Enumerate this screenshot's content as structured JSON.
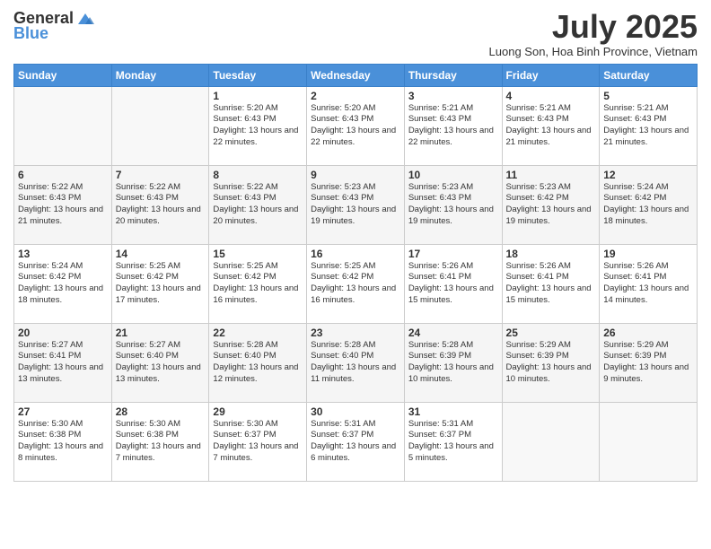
{
  "header": {
    "logo_general": "General",
    "logo_blue": "Blue",
    "month_title": "July 2025",
    "location": "Luong Son, Hoa Binh Province, Vietnam"
  },
  "days_of_week": [
    "Sunday",
    "Monday",
    "Tuesday",
    "Wednesday",
    "Thursday",
    "Friday",
    "Saturday"
  ],
  "weeks": [
    [
      {
        "day": "",
        "info": ""
      },
      {
        "day": "",
        "info": ""
      },
      {
        "day": "1",
        "info": "Sunrise: 5:20 AM\nSunset: 6:43 PM\nDaylight: 13 hours and 22 minutes."
      },
      {
        "day": "2",
        "info": "Sunrise: 5:20 AM\nSunset: 6:43 PM\nDaylight: 13 hours and 22 minutes."
      },
      {
        "day": "3",
        "info": "Sunrise: 5:21 AM\nSunset: 6:43 PM\nDaylight: 13 hours and 22 minutes."
      },
      {
        "day": "4",
        "info": "Sunrise: 5:21 AM\nSunset: 6:43 PM\nDaylight: 13 hours and 21 minutes."
      },
      {
        "day": "5",
        "info": "Sunrise: 5:21 AM\nSunset: 6:43 PM\nDaylight: 13 hours and 21 minutes."
      }
    ],
    [
      {
        "day": "6",
        "info": "Sunrise: 5:22 AM\nSunset: 6:43 PM\nDaylight: 13 hours and 21 minutes."
      },
      {
        "day": "7",
        "info": "Sunrise: 5:22 AM\nSunset: 6:43 PM\nDaylight: 13 hours and 20 minutes."
      },
      {
        "day": "8",
        "info": "Sunrise: 5:22 AM\nSunset: 6:43 PM\nDaylight: 13 hours and 20 minutes."
      },
      {
        "day": "9",
        "info": "Sunrise: 5:23 AM\nSunset: 6:43 PM\nDaylight: 13 hours and 19 minutes."
      },
      {
        "day": "10",
        "info": "Sunrise: 5:23 AM\nSunset: 6:43 PM\nDaylight: 13 hours and 19 minutes."
      },
      {
        "day": "11",
        "info": "Sunrise: 5:23 AM\nSunset: 6:42 PM\nDaylight: 13 hours and 19 minutes."
      },
      {
        "day": "12",
        "info": "Sunrise: 5:24 AM\nSunset: 6:42 PM\nDaylight: 13 hours and 18 minutes."
      }
    ],
    [
      {
        "day": "13",
        "info": "Sunrise: 5:24 AM\nSunset: 6:42 PM\nDaylight: 13 hours and 18 minutes."
      },
      {
        "day": "14",
        "info": "Sunrise: 5:25 AM\nSunset: 6:42 PM\nDaylight: 13 hours and 17 minutes."
      },
      {
        "day": "15",
        "info": "Sunrise: 5:25 AM\nSunset: 6:42 PM\nDaylight: 13 hours and 16 minutes."
      },
      {
        "day": "16",
        "info": "Sunrise: 5:25 AM\nSunset: 6:42 PM\nDaylight: 13 hours and 16 minutes."
      },
      {
        "day": "17",
        "info": "Sunrise: 5:26 AM\nSunset: 6:41 PM\nDaylight: 13 hours and 15 minutes."
      },
      {
        "day": "18",
        "info": "Sunrise: 5:26 AM\nSunset: 6:41 PM\nDaylight: 13 hours and 15 minutes."
      },
      {
        "day": "19",
        "info": "Sunrise: 5:26 AM\nSunset: 6:41 PM\nDaylight: 13 hours and 14 minutes."
      }
    ],
    [
      {
        "day": "20",
        "info": "Sunrise: 5:27 AM\nSunset: 6:41 PM\nDaylight: 13 hours and 13 minutes."
      },
      {
        "day": "21",
        "info": "Sunrise: 5:27 AM\nSunset: 6:40 PM\nDaylight: 13 hours and 13 minutes."
      },
      {
        "day": "22",
        "info": "Sunrise: 5:28 AM\nSunset: 6:40 PM\nDaylight: 13 hours and 12 minutes."
      },
      {
        "day": "23",
        "info": "Sunrise: 5:28 AM\nSunset: 6:40 PM\nDaylight: 13 hours and 11 minutes."
      },
      {
        "day": "24",
        "info": "Sunrise: 5:28 AM\nSunset: 6:39 PM\nDaylight: 13 hours and 10 minutes."
      },
      {
        "day": "25",
        "info": "Sunrise: 5:29 AM\nSunset: 6:39 PM\nDaylight: 13 hours and 10 minutes."
      },
      {
        "day": "26",
        "info": "Sunrise: 5:29 AM\nSunset: 6:39 PM\nDaylight: 13 hours and 9 minutes."
      }
    ],
    [
      {
        "day": "27",
        "info": "Sunrise: 5:30 AM\nSunset: 6:38 PM\nDaylight: 13 hours and 8 minutes."
      },
      {
        "day": "28",
        "info": "Sunrise: 5:30 AM\nSunset: 6:38 PM\nDaylight: 13 hours and 7 minutes."
      },
      {
        "day": "29",
        "info": "Sunrise: 5:30 AM\nSunset: 6:37 PM\nDaylight: 13 hours and 7 minutes."
      },
      {
        "day": "30",
        "info": "Sunrise: 5:31 AM\nSunset: 6:37 PM\nDaylight: 13 hours and 6 minutes."
      },
      {
        "day": "31",
        "info": "Sunrise: 5:31 AM\nSunset: 6:37 PM\nDaylight: 13 hours and 5 minutes."
      },
      {
        "day": "",
        "info": ""
      },
      {
        "day": "",
        "info": ""
      }
    ]
  ]
}
